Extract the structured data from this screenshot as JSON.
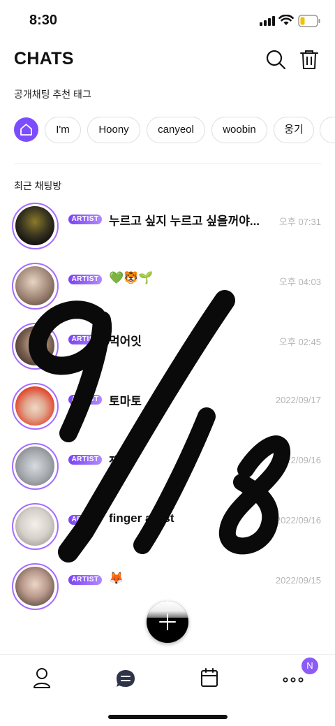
{
  "status_bar": {
    "time": "8:30"
  },
  "header": {
    "title": "CHATS"
  },
  "tags_section": {
    "label": "공개채팅 추천 태그",
    "tags": [
      "I'm",
      "Hoony",
      "canyeol",
      "woobin",
      "웅기"
    ]
  },
  "recent_section": {
    "label": "최근 채팅방",
    "chats": [
      {
        "badge": "ARTIST",
        "name": "누르고 싶지 누르고 싶을꺼야...",
        "time": "오후 07:31"
      },
      {
        "badge": "ARTIST",
        "name": "💚🐯🌱",
        "time": "오후 04:03"
      },
      {
        "badge": "ARTIST",
        "name": "먹어잇",
        "time": "오후 02:45"
      },
      {
        "badge": "ARTIST",
        "name": "토마토",
        "time": "2022/09/17"
      },
      {
        "badge": "ARTIST",
        "name": "잰",
        "time": "2022/09/16"
      },
      {
        "badge": "ARTIST",
        "name": "finger artist",
        "time": "2022/09/16"
      },
      {
        "badge": "ARTIST",
        "name": "🦊",
        "time": "2022/09/15"
      }
    ]
  },
  "bottom_nav": {
    "items": [
      "profile-icon",
      "chat-bubble-icon",
      "calendar-icon",
      "more-icon"
    ],
    "badge": "N"
  },
  "colors": {
    "accent": "#7c4dff",
    "ring": "#a56cff",
    "time_text": "#b5b5b5"
  }
}
